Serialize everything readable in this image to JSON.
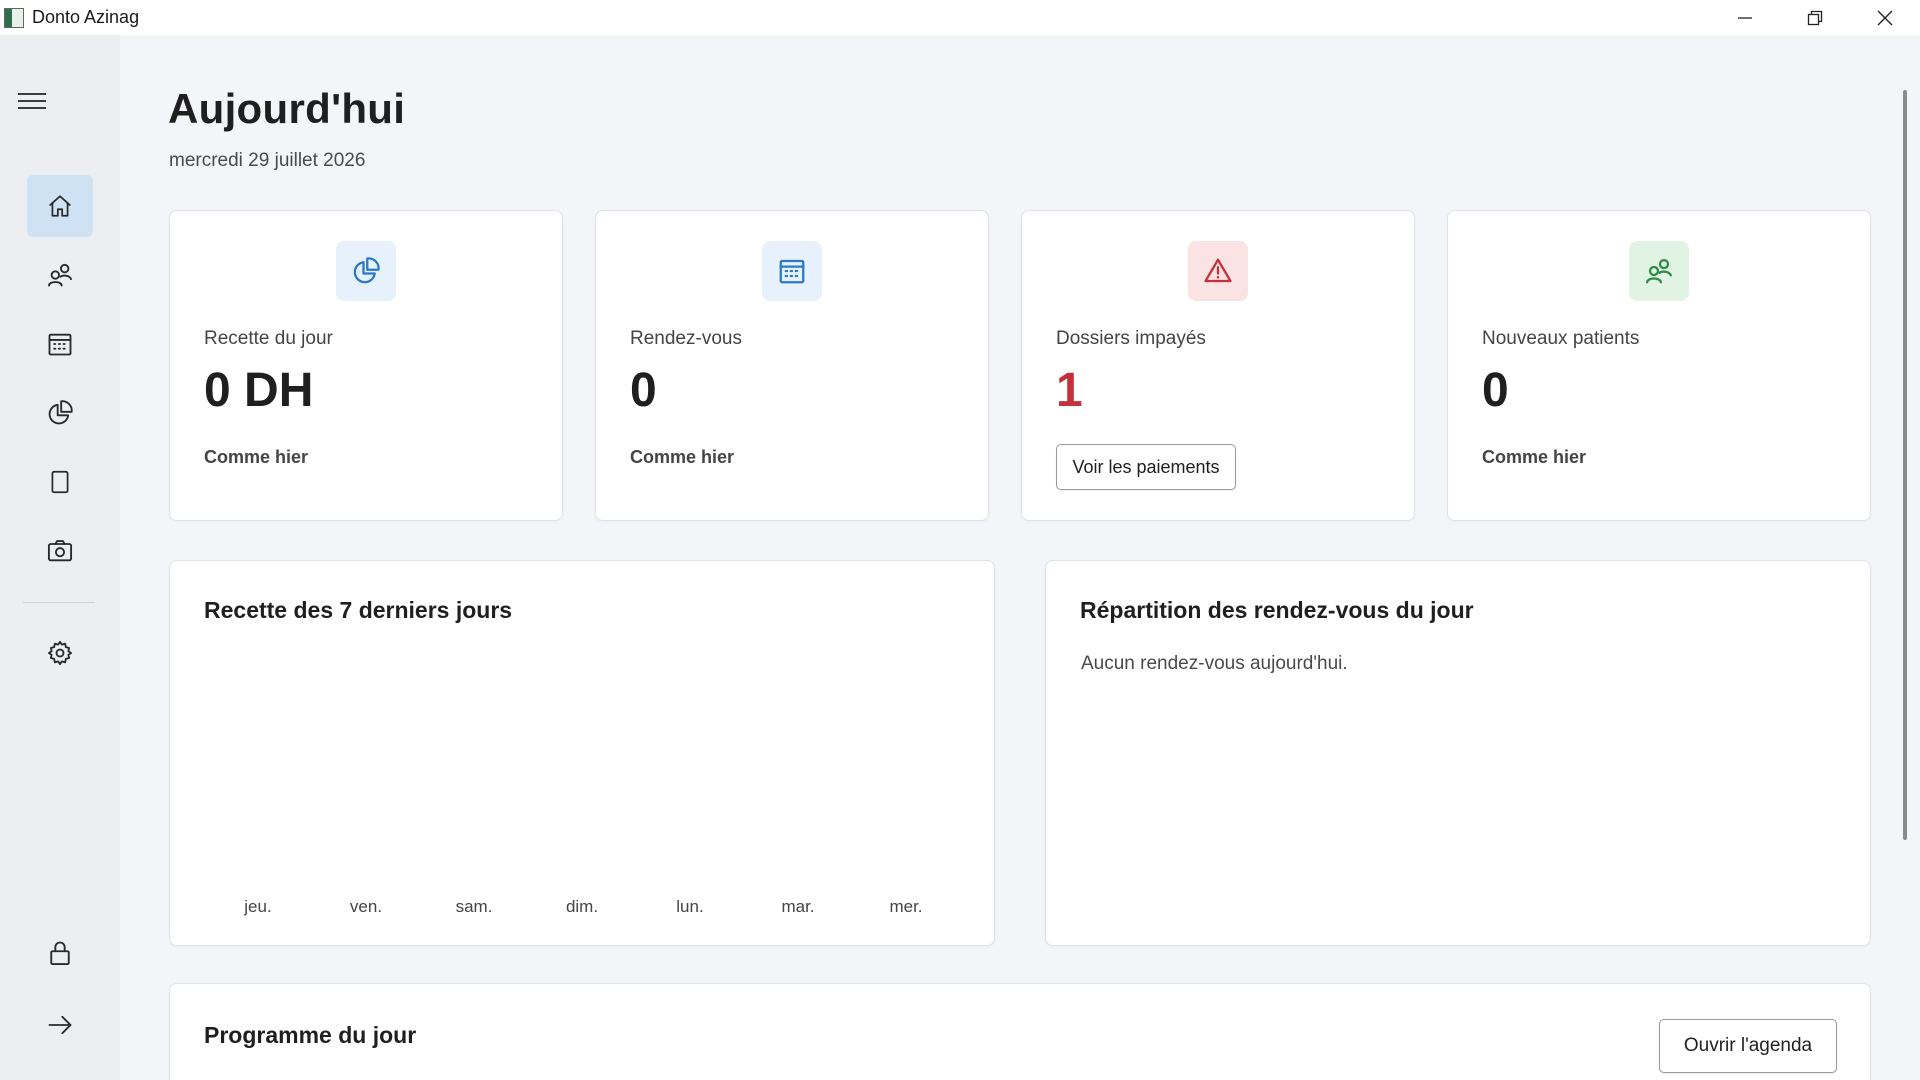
{
  "window": {
    "title": "Donto Azinag"
  },
  "page": {
    "title": "Aujourd'hui",
    "date": "mercredi 29 juillet 2026"
  },
  "sidebar": {
    "items": [
      {
        "icon": "home-icon",
        "active": true
      },
      {
        "icon": "patients-icon",
        "active": false
      },
      {
        "icon": "calendar-icon",
        "active": false
      },
      {
        "icon": "pie-chart-icon",
        "active": false
      },
      {
        "icon": "document-icon",
        "active": false
      },
      {
        "icon": "camera-icon",
        "active": false
      },
      {
        "icon": "gear-icon",
        "active": false
      },
      {
        "icon": "lock-icon",
        "active": false
      },
      {
        "icon": "arrow-right-icon",
        "active": false
      }
    ]
  },
  "stats": [
    {
      "icon": "pie-chart-icon",
      "label": "Recette du jour",
      "value": "0 DH",
      "sub": "Comme hier"
    },
    {
      "icon": "calendar-icon",
      "label": "Rendez-vous",
      "value": "0",
      "sub": "Comme hier"
    },
    {
      "icon": "warning-icon",
      "label": "Dossiers impayés",
      "value": "1",
      "button": "Voir les paiements"
    },
    {
      "icon": "patients-icon",
      "label": "Nouveaux patients",
      "value": "0",
      "sub": "Comme hier"
    }
  ],
  "colors": {
    "alert": "#c4313b",
    "blue_icon": "#2a78c6",
    "red_icon": "#c4313b",
    "green_icon": "#2e8a45"
  },
  "revenue_chart": {
    "title": "Recette des 7 derniers jours",
    "days": [
      "jeu.",
      "ven.",
      "sam.",
      "dim.",
      "lun.",
      "mar.",
      "mer."
    ]
  },
  "chart_data": {
    "type": "bar",
    "categories": [
      "jeu.",
      "ven.",
      "sam.",
      "dim.",
      "lun.",
      "mar.",
      "mer."
    ],
    "values": [
      0,
      0,
      0,
      0,
      0,
      0,
      0
    ],
    "title": "Recette des 7 derniers jours"
  },
  "appointments_breakdown": {
    "title": "Répartition des rendez-vous du jour",
    "empty_text": "Aucun rendez-vous aujourd'hui."
  },
  "program": {
    "title": "Programme du jour",
    "button": "Ouvrir l'agenda"
  }
}
